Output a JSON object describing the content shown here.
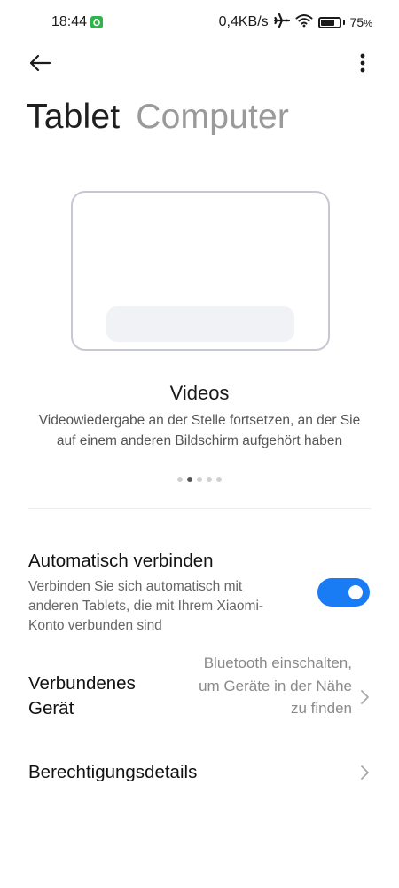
{
  "status_bar": {
    "time": "18:44",
    "network_speed": "0,4KB/s",
    "battery_percent": "75",
    "battery_suffix": "%",
    "battery_level": 0.75,
    "icons": [
      "app-notification-icon",
      "airplane-icon",
      "wifi-icon",
      "battery-icon"
    ]
  },
  "app_bar": {
    "back_icon": "arrow-left-icon",
    "more_icon": "more-vertical-icon"
  },
  "tabs": [
    {
      "label": "Tablet",
      "active": true
    },
    {
      "label": "Computer",
      "active": false
    }
  ],
  "carousel": {
    "title": "Videos",
    "description": "Videowiedergabe an der Stelle fortsetzen, an der Sie auf einem anderen Bildschirm aufgehört haben",
    "page_count": 5,
    "current_page": 2
  },
  "settings": {
    "auto_connect": {
      "title": "Automatisch verbinden",
      "description": "Verbinden Sie sich automatisch mit anderen Tablets, die mit Ihrem Xiaomi-Konto verbunden sind",
      "enabled": true
    },
    "connected_device": {
      "title": "Verbundenes Gerät",
      "value": "Bluetooth einschalten, um Geräte in der Nähe zu finden"
    },
    "permission_details": {
      "title": "Berechtigungsdetails"
    }
  },
  "colors": {
    "accent": "#1a7cf5",
    "inactive_tab": "#9a9a9a",
    "illustration_border": "#c6c8d3"
  }
}
